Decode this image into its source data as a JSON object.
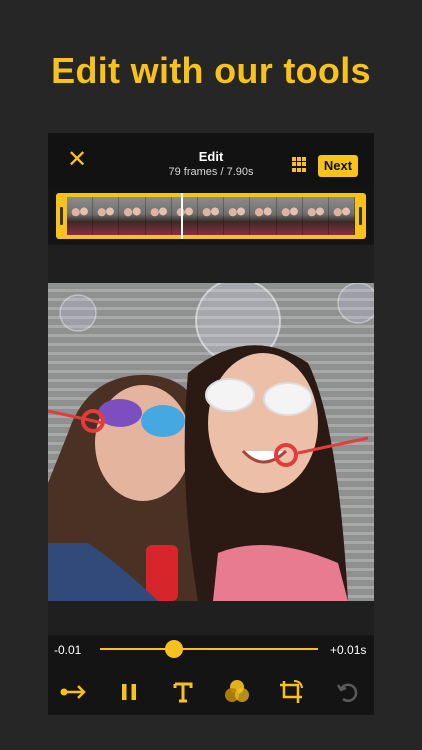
{
  "headline": "Edit with our tools",
  "header": {
    "title": "Edit",
    "subtitle": "79 frames / 7.90s",
    "next_label": "Next",
    "close_icon": "close-icon",
    "grid_icon": "grid-icon"
  },
  "timeline": {
    "frame_thumbnails": 11,
    "playhead_position": 0.42
  },
  "playback": {
    "start_label": "-0.01",
    "end_label": "+0.01s",
    "slider_value": 0.34
  },
  "toolbar": [
    {
      "icon": "arrow-direction-icon"
    },
    {
      "icon": "pause-icon"
    },
    {
      "icon": "text-icon"
    },
    {
      "icon": "color-filter-icon"
    },
    {
      "icon": "crop-rotate-icon"
    },
    {
      "icon": "undo-icon"
    }
  ],
  "colors": {
    "accent": "#F7C21B",
    "background": "#262626",
    "panel": "#141414"
  }
}
